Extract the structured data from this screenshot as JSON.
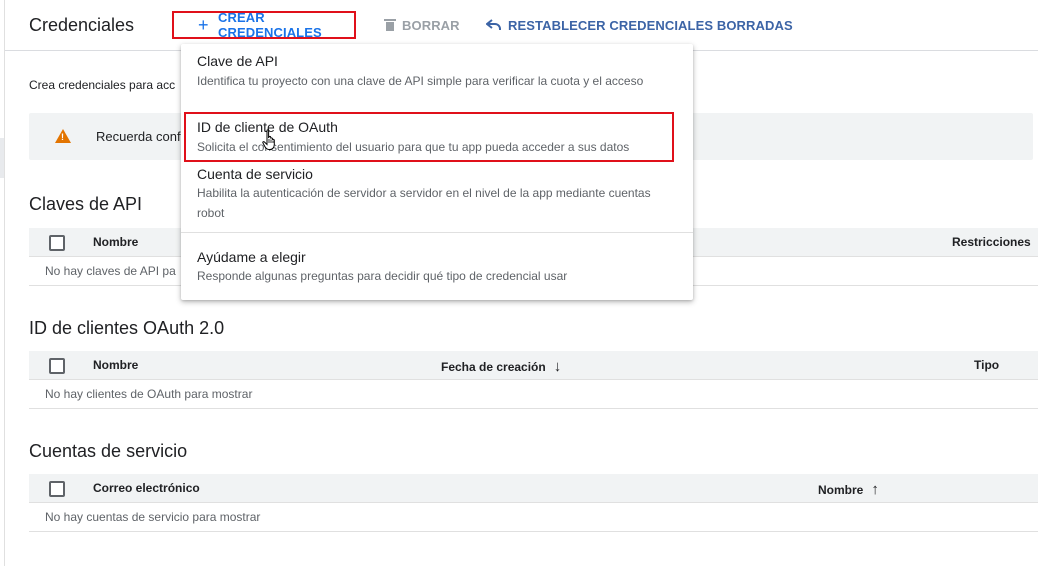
{
  "header": {
    "title": "Credenciales",
    "create_label": "CREAR CREDENCIALES",
    "delete_label": "BORRAR",
    "restore_label": "RESTABLECER CREDENCIALES BORRADAS"
  },
  "subtitle": "Crea credenciales para acc",
  "banner": {
    "text": "Recuerda confi"
  },
  "api_keys": {
    "title": "Claves de API",
    "columns": [
      "Nombre",
      "Restricciones"
    ],
    "empty": "No hay claves de API pa"
  },
  "oauth_clients": {
    "title": "ID de clientes OAuth 2.0",
    "columns": [
      "Nombre",
      "Fecha de creación",
      "Tipo"
    ],
    "sort_icon": "arrow-down-icon",
    "empty": "No hay clientes de OAuth para mostrar"
  },
  "service_accounts": {
    "title": "Cuentas de servicio",
    "columns": [
      "Correo electrónico",
      "Nombre"
    ],
    "sort_icon": "arrow-up-icon",
    "empty": "No hay cuentas de servicio para mostrar"
  },
  "dropdown": {
    "items": [
      {
        "title": "Clave de API",
        "desc": "Identifica tu proyecto con una clave de API simple para verificar la cuota y el acceso"
      },
      {
        "title": "ID de cliente de OAuth",
        "desc": "Solicita el consentimiento del usuario para que tu app pueda acceder a sus datos",
        "highlighted": true
      },
      {
        "title": "Cuenta de servicio",
        "desc": "Habilita la autenticación de servidor a servidor en el nivel de la app mediante cuentas robot"
      },
      {
        "title": "Ayúdame a elegir",
        "desc": "Responde algunas preguntas para decidir qué tipo de credencial usar"
      }
    ]
  },
  "colors": {
    "accent": "#1a73e8",
    "highlight_border": "#e0101a",
    "warning": "#e37400"
  }
}
